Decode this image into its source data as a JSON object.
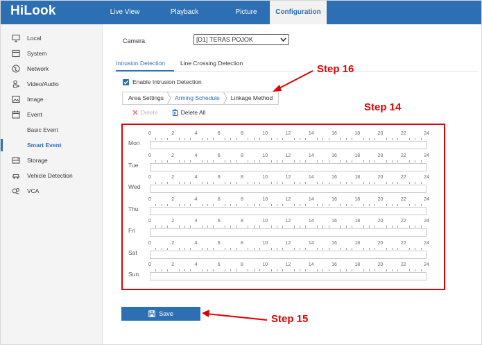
{
  "app": {
    "logo": "HiLook"
  },
  "topnav": [
    {
      "label": "Live View",
      "active": false
    },
    {
      "label": "Playback",
      "active": false
    },
    {
      "label": "Picture",
      "active": false
    },
    {
      "label": "Configuration",
      "active": true
    }
  ],
  "sidebar": {
    "items": [
      {
        "label": "Local",
        "icon": "monitor-icon"
      },
      {
        "label": "System",
        "icon": "system-icon"
      },
      {
        "label": "Network",
        "icon": "globe-icon"
      },
      {
        "label": "Video/Audio",
        "icon": "video-audio-icon"
      },
      {
        "label": "Image",
        "icon": "image-icon"
      },
      {
        "label": "Event",
        "icon": "calendar-icon"
      },
      {
        "label": "Basic Event",
        "icon": ""
      },
      {
        "label": "Smart Event",
        "icon": ""
      },
      {
        "label": "Storage",
        "icon": "storage-icon"
      },
      {
        "label": "Vehicle Detection",
        "icon": "car-icon"
      },
      {
        "label": "VCA",
        "icon": "vca-icon"
      }
    ],
    "selected": "Smart Event"
  },
  "camera": {
    "label": "Camera",
    "value": "[D1] TERAS POJOK"
  },
  "tabs": [
    {
      "label": "Intrusion Detection",
      "active": true
    },
    {
      "label": "Line Crossing Detection",
      "active": false
    }
  ],
  "enable": {
    "label": "Enable Intrusion Detection",
    "checked": true
  },
  "subtabs": [
    {
      "label": "Area Settings",
      "active": false
    },
    {
      "label": "Arming Schedule",
      "active": true
    },
    {
      "label": "Linkage Method",
      "active": false
    }
  ],
  "toolbar": {
    "delete_label": "Delete",
    "delete_all_label": "Delete All"
  },
  "schedule": {
    "hours": [
      "0",
      "2",
      "4",
      "6",
      "8",
      "10",
      "12",
      "14",
      "16",
      "18",
      "20",
      "22",
      "24"
    ],
    "days": [
      "Mon",
      "Tue",
      "Wed",
      "Thu",
      "Fri",
      "Sat",
      "Sun"
    ]
  },
  "save_label": "Save",
  "annotations": {
    "step14": "Step 14",
    "step15": "Step 15",
    "step16": "Step 16"
  },
  "colors": {
    "brand": "#2c6fb3",
    "annotation": "#e00000"
  }
}
